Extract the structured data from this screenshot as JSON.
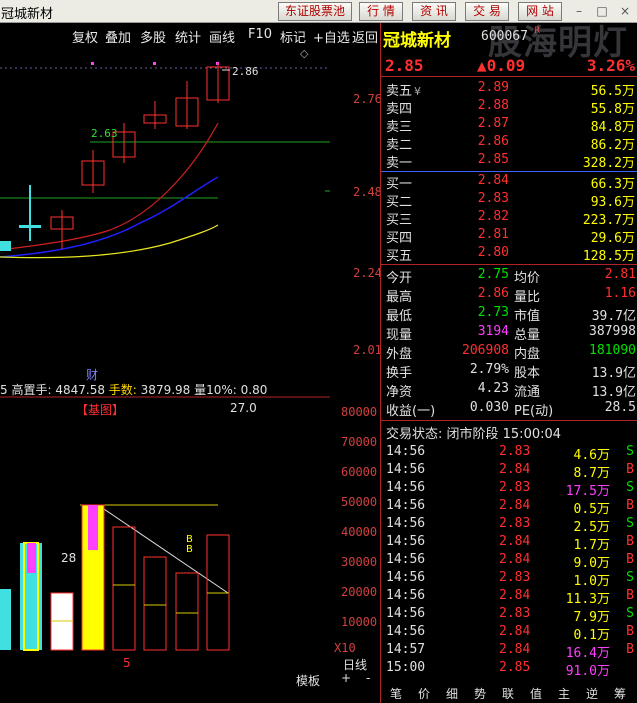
{
  "window": {
    "title": "冠城新材",
    "buttons": [
      "东证股票池",
      "行 情",
      "资 讯",
      "交 易",
      "网 站"
    ]
  },
  "toolbar": {
    "items": [
      "复权",
      "叠加",
      "多股",
      "统计",
      "画线",
      "F10",
      "标记",
      "+自选",
      "返回"
    ]
  },
  "price_axis": [
    "2.76",
    "2.48",
    "2.24",
    "2.01"
  ],
  "chart_labels": {
    "high_mark": "2.86",
    "ma_mark": "2.63"
  },
  "info_bar": {
    "prefix": "5",
    "label1": "高置手:",
    "value1": "4847.58",
    "label2": "手数:",
    "value2": "3879.98",
    "label3": "量10%:",
    "value3": "0.80",
    "cai": "财"
  },
  "indicator": {
    "name": "【基图】",
    "value": "27.0"
  },
  "volume_axis": [
    "80000",
    "70000",
    "60000",
    "50000",
    "40000",
    "30000",
    "20000",
    "10000"
  ],
  "volume_labels": {
    "marker_28": "28",
    "marker_bb": "BB",
    "marker_5": "5",
    "x10": "X10"
  },
  "bottom_left": {
    "period": "日线",
    "template": "模板",
    "plus": "+",
    "minus": "-"
  },
  "quote": {
    "name": "冠城新材",
    "code": "600067",
    "r_badge": "R",
    "watermark": "股海明灯",
    "price": "2.85",
    "change": "▲0.09",
    "change_pct": "3.26%",
    "asks": [
      {
        "label": "卖五",
        "mark": "¥",
        "price": "2.89",
        "volume": "56.5万"
      },
      {
        "label": "卖四",
        "mark": "",
        "price": "2.88",
        "volume": "55.8万"
      },
      {
        "label": "卖三",
        "mark": "",
        "price": "2.87",
        "volume": "84.8万"
      },
      {
        "label": "卖二",
        "mark": "",
        "price": "2.86",
        "volume": "86.2万"
      },
      {
        "label": "卖一",
        "mark": "",
        "price": "2.85",
        "volume": "328.2万"
      }
    ],
    "bids": [
      {
        "label": "买一",
        "price": "2.84",
        "volume": "66.3万"
      },
      {
        "label": "买二",
        "price": "2.83",
        "volume": "93.6万"
      },
      {
        "label": "买三",
        "price": "2.82",
        "volume": "223.7万"
      },
      {
        "label": "买四",
        "price": "2.81",
        "volume": "29.6万"
      },
      {
        "label": "买五",
        "price": "2.80",
        "volume": "128.5万"
      }
    ],
    "stats": [
      {
        "l1": "今开",
        "v1": "2.75",
        "c1": "green",
        "l2": "均价",
        "v2": "2.81",
        "c2": "red"
      },
      {
        "l1": "最高",
        "v1": "2.86",
        "c1": "red",
        "l2": "量比",
        "v2": "1.16",
        "c2": "red"
      },
      {
        "l1": "最低",
        "v1": "2.73",
        "c1": "green",
        "l2": "市值",
        "v2": "39.7亿",
        "c2": "white"
      },
      {
        "l1": "现量",
        "v1": "3194",
        "c1": "mag",
        "l2": "总量",
        "v2": "387998",
        "c2": "white"
      },
      {
        "l1": "外盘",
        "v1": "206908",
        "c1": "red",
        "l2": "内盘",
        "v2": "181090",
        "c2": "green"
      },
      {
        "l1": "换手",
        "v1": "2.79%",
        "c1": "white",
        "l2": "股本",
        "v2": "13.9亿",
        "c2": "white"
      },
      {
        "l1": "净资",
        "v1": "4.23",
        "c1": "white",
        "l2": "流通",
        "v2": "13.9亿",
        "c2": "white"
      },
      {
        "l1": "收益(一)",
        "v1": "0.030",
        "c1": "white",
        "l2": "PE(动)",
        "v2": "28.5",
        "c2": "white"
      }
    ],
    "status": "交易状态: 闭市阶段  15:00:04",
    "ticks": [
      {
        "time": "14:56",
        "price": "2.83",
        "vol": "4.6万",
        "vc": "yellow",
        "dir": "S"
      },
      {
        "time": "14:56",
        "price": "2.84",
        "vol": "8.7万",
        "vc": "yellow",
        "dir": "B"
      },
      {
        "time": "14:56",
        "price": "2.83",
        "vol": "17.5万",
        "vc": "mag",
        "dir": "S"
      },
      {
        "time": "14:56",
        "price": "2.84",
        "vol": "0.5万",
        "vc": "yellow",
        "dir": "B"
      },
      {
        "time": "14:56",
        "price": "2.83",
        "vol": "2.5万",
        "vc": "yellow",
        "dir": "S"
      },
      {
        "time": "14:56",
        "price": "2.84",
        "vol": "1.7万",
        "vc": "yellow",
        "dir": "B"
      },
      {
        "time": "14:56",
        "price": "2.84",
        "vol": "9.0万",
        "vc": "yellow",
        "dir": "B"
      },
      {
        "time": "14:56",
        "price": "2.83",
        "vol": "1.0万",
        "vc": "yellow",
        "dir": "S"
      },
      {
        "time": "14:56",
        "price": "2.84",
        "vol": "11.3万",
        "vc": "yellow",
        "dir": "B"
      },
      {
        "time": "14:56",
        "price": "2.83",
        "vol": "7.9万",
        "vc": "yellow",
        "dir": "S"
      },
      {
        "time": "14:56",
        "price": "2.84",
        "vol": "0.1万",
        "vc": "yellow",
        "dir": "B"
      },
      {
        "time": "14:57",
        "price": "2.84",
        "vol": "16.4万",
        "vc": "mag",
        "dir": "B"
      },
      {
        "time": "15:00",
        "price": "2.85",
        "vol": "91.0万",
        "vc": "mag",
        "dir": ""
      }
    ],
    "bottom_tabs": [
      "笔",
      "价",
      "细",
      "势",
      "联",
      "值",
      "主",
      "逆",
      "筹"
    ]
  },
  "colors": {
    "up": "#ff3030",
    "down": "#00e000",
    "accent": "#ffff00",
    "ma1": "#d02020",
    "ma2": "#2020ff",
    "ma3": "#e8e820"
  }
}
